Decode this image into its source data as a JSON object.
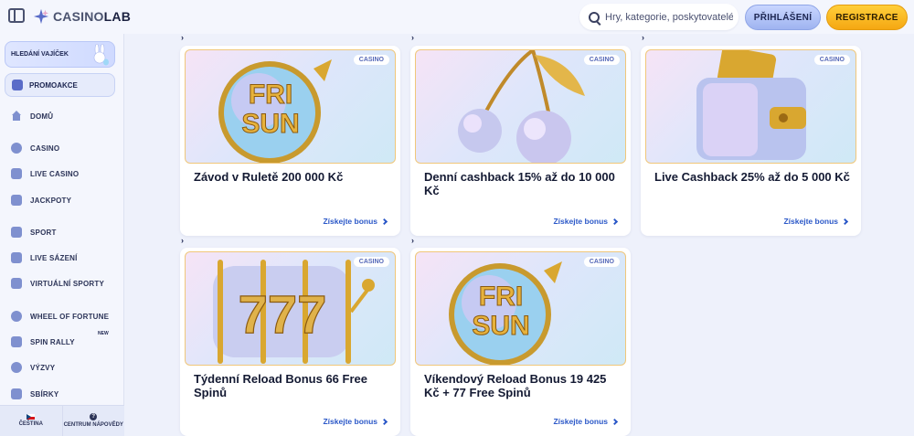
{
  "header": {
    "logo_part1": "CASINO",
    "logo_part2": "LAB",
    "search_placeholder": "Hry, kategorie, poskytovatelé",
    "login_label": "PŘIHLÁŠENÍ",
    "register_label": "REGISTRACE"
  },
  "sidebar": {
    "easter_label": "HLEDÁNÍ VAJÍČEK",
    "promo_label": "PROMOAKCE",
    "items": [
      {
        "label": "DOMŮ",
        "icon": "home-icon"
      },
      {
        "label": "CASINO",
        "icon": "casino-icon"
      },
      {
        "label": "LIVE CASINO",
        "icon": "live-casino-icon"
      },
      {
        "label": "JACKPOTY",
        "icon": "jackpot-icon"
      },
      {
        "label": "SPORT",
        "icon": "sport-icon"
      },
      {
        "label": "LIVE SÁZENÍ",
        "icon": "live-betting-icon"
      },
      {
        "label": "VIRTUÁLNÍ SPORTY",
        "icon": "virtual-sports-icon"
      },
      {
        "label": "WHEEL OF FORTUNE",
        "icon": "wheel-icon"
      },
      {
        "label": "SPIN RALLY",
        "icon": "spin-rally-icon"
      },
      {
        "label": "VÝZVY",
        "icon": "challenges-icon"
      },
      {
        "label": "SBÍRKY",
        "icon": "collections-icon"
      }
    ],
    "new_badge": "NEW",
    "language_label": "ČEŠTINA",
    "help_label": "CENTRUM NÁPOVĚDY"
  },
  "promotions": [
    {
      "tag": "CASINO",
      "title": "Závod v Ruletě 200 000 Kč",
      "cta": "Získejte bonus",
      "art": "frisun"
    },
    {
      "tag": "CASINO",
      "title": "Denní cashback 15% až do 10 000 Kč",
      "cta": "Získejte bonus",
      "art": "cherries"
    },
    {
      "tag": "CASINO",
      "title": "Live Cashback 25% až do 5 000 Kč",
      "cta": "Získejte bonus",
      "art": "wallet"
    },
    {
      "tag": "CASINO",
      "title": "Týdenní Reload Bonus 66 Free Spinů",
      "cta": "Získejte bonus",
      "art": "slot777"
    },
    {
      "tag": "CASINO",
      "title": "Víkendový Reload Bonus 19 425 Kč + 77 Free Spinů",
      "cta": "Získejte bonus",
      "art": "frisun"
    }
  ],
  "art_text": {
    "fri": "FRI",
    "sun": "SUN",
    "seven": "777"
  },
  "colors": {
    "login": "#b3c4f8",
    "register": "#f7b520",
    "link": "#2b58c8"
  }
}
